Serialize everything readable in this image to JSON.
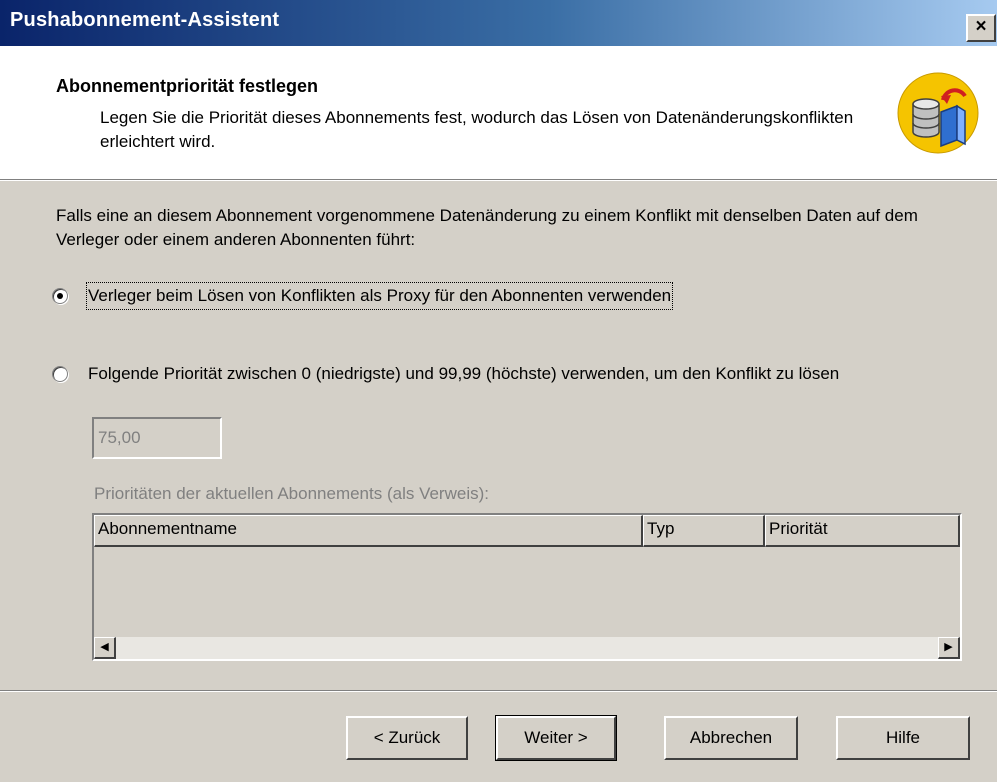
{
  "window": {
    "title": "Pushabonnement-Assistent",
    "close_label": "×"
  },
  "header": {
    "title": "Abonnementpriorität festlegen",
    "description": "Legen Sie die Priorität dieses Abonnements fest, wodurch das Lösen von Datenänderungskonflikten erleichtert wird.",
    "icon": "database-merge-icon"
  },
  "body": {
    "intro": "Falls eine an diesem Abonnement vorgenommene Datenänderung zu einem Konflikt mit denselben Daten auf dem Verleger oder einem anderen Abonnenten führt:",
    "option_proxy": {
      "label": "Verleger beim Lösen von Konflikten als Proxy für den Abonnenten verwenden",
      "selected": true
    },
    "option_priority": {
      "label": "Folgende Priorität zwischen 0 (niedrigste) und 99,99 (höchste) verwenden, um den Konflikt zu lösen",
      "selected": false
    },
    "priority_value": "75,00",
    "list_label": "Prioritäten der aktuellen Abonnements (als Verweis):",
    "columns": [
      "Abonnementname",
      "Typ",
      "Priorität"
    ]
  },
  "buttons": {
    "back": "< Zurück",
    "next": "Weiter >",
    "cancel": "Abbrechen",
    "help": "Hilfe"
  }
}
